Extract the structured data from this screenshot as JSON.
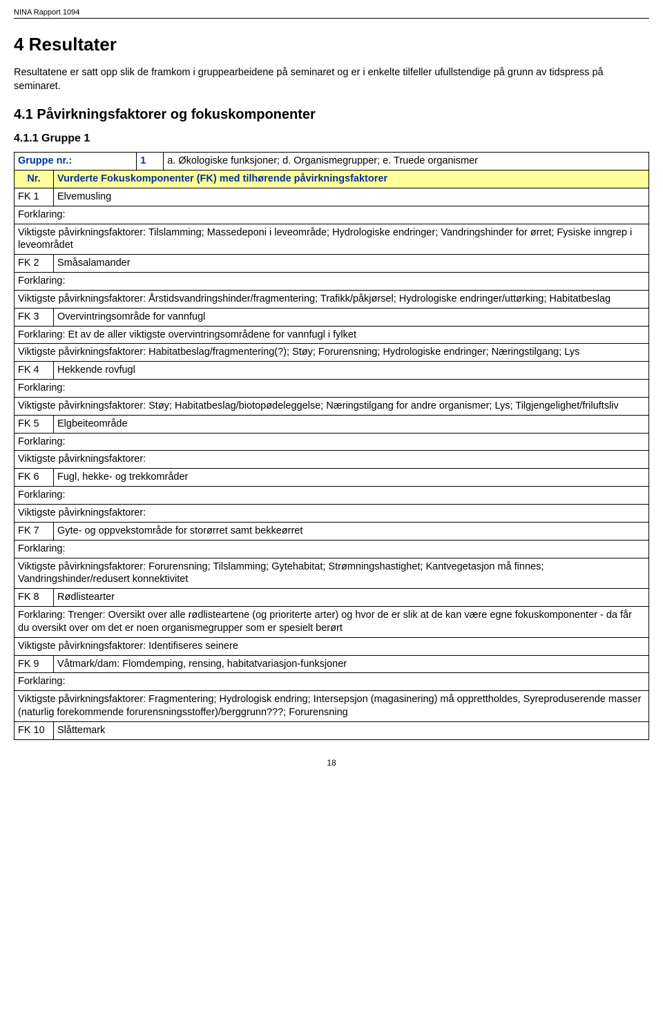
{
  "running_head": "NINA Rapport 1094",
  "h1": "4  Resultater",
  "intro": "Resultatene er satt opp slik de framkom i gruppearbeidene på seminaret og er i enkelte tilfeller ufullstendige på grunn av tidspress på seminaret.",
  "h2": "4.1 Påvirkningsfaktorer og fokuskomponenter",
  "h3": "4.1.1 Gruppe 1",
  "table": {
    "group_row": {
      "label": "Gruppe nr.:",
      "num": "1",
      "desc": "a. Økologiske funksjoner; d. Organismegrupper; e. Truede organismer"
    },
    "fk_header": {
      "col1": "Nr.",
      "col2": "Vurderte Fokuskomponenter (FK) med tilhørende påvirkningsfaktorer"
    },
    "rows": [
      {
        "fk_label": "FK 1",
        "fk_name": "Elvemusling",
        "expl_label": "Forklaring:",
        "fact": "Viktigste påvirkningsfaktorer: Tilslamming; Massedeponi i leveområde; Hydrologiske endringer; Vandringshinder for ørret; Fysiske inngrep i leveområdet"
      },
      {
        "fk_label": "FK 2",
        "fk_name": "Småsalamander",
        "expl_label": "Forklaring:",
        "fact": "Viktigste påvirkningsfaktorer: Årstidsvandringshinder/fragmentering; Trafikk/påkjørsel; Hydrologiske endringer/uttørking; Habitatbeslag"
      },
      {
        "fk_label": "FK 3",
        "fk_name": "Overvintringsområde for vannfugl",
        "expl_label": "Forklaring: ",
        "expl_text": "Et av de aller viktigste overvintringsområdene for vannfugl i fylket",
        "fact": "Viktigste påvirkningsfaktorer: Habitatbeslag/fragmentering(?); Støy; Forurensning; Hydrologiske endringer; Næringstilgang; Lys"
      },
      {
        "fk_label": "FK 4",
        "fk_name": "Hekkende rovfugl",
        "expl_label": "Forklaring:",
        "fact": "Viktigste påvirkningsfaktorer: Støy; Habitatbeslag/biotopødeleggelse; Næringstilgang for andre organismer; Lys; Tilgjengelighet/friluftsliv"
      },
      {
        "fk_label": "FK 5",
        "fk_name": "Elgbeiteområde",
        "expl_label": "Forklaring:",
        "fact": "Viktigste påvirkningsfaktorer:"
      },
      {
        "fk_label": "FK 6",
        "fk_name": "Fugl, hekke- og trekkområder",
        "expl_label": "Forklaring:",
        "fact": "Viktigste påvirkningsfaktorer:"
      },
      {
        "fk_label": "FK 7",
        "fk_name": "Gyte- og oppvekstområde for storørret samt bekkeørret",
        "expl_label": "Forklaring:",
        "fact": "Viktigste påvirkningsfaktorer: Forurensning; Tilslamming; Gytehabitat; Strømningshastighet; Kantvegetasjon må finnes; Vandringshinder/redusert konnektivitet"
      },
      {
        "fk_label": "FK 8",
        "fk_name": "Rødlistearter",
        "expl_label": "Forklaring: ",
        "expl_text": "Trenger: Oversikt over alle rødlisteartene (og prioriterte arter) og hvor de er slik at de kan være egne fokuskomponenter - da får du oversikt over om det er noen organismegrupper som er spesielt berørt",
        "fact": "Viktigste påvirkningsfaktorer: Identifiseres seinere"
      },
      {
        "fk_label": "FK 9",
        "fk_name": "Våtmark/dam: Flomdemping, rensing, habitatvariasjon-funksjoner",
        "expl_label": "Forklaring:",
        "fact": "Viktigste påvirkningsfaktorer: Fragmentering; Hydrologisk endring; Intersepsjon (magasinering) må opprettholdes, Syreproduserende masser (naturlig forekommende forurensningsstoffer)/berggrunn???; Forurensning"
      },
      {
        "fk_label": "FK 10",
        "fk_name": "Slåttemark"
      }
    ]
  },
  "page_number": "18"
}
